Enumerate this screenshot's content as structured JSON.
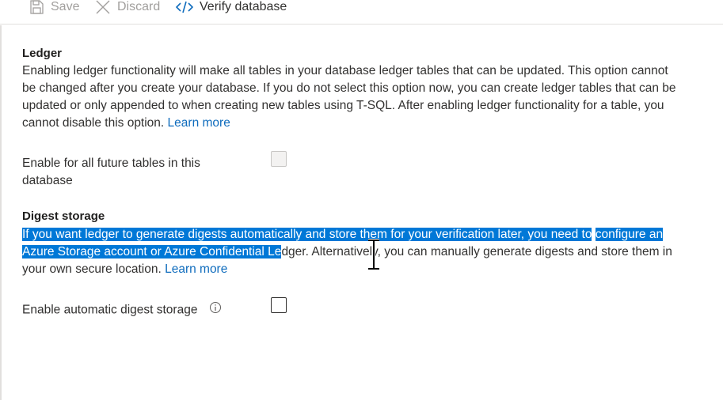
{
  "toolbar": {
    "save_label": "Save",
    "discard_label": "Discard",
    "verify_label": "Verify database"
  },
  "ledger": {
    "title": "Ledger",
    "description": "Enabling ledger functionality will make all tables in your database ledger tables that can be updated. This option cannot be changed after you create your database. If you do not select this option now, you can create ledger tables that can be updated or only appended to when creating new tables using T-SQL. After enabling ledger functionality for a table, you cannot disable this option.",
    "learn_more": "Learn more",
    "enable_label": "Enable for all future tables in this database",
    "enable_checked": false,
    "enable_disabled": true
  },
  "digest": {
    "title": "Digest storage",
    "description_selected_1": "If you want ledger to generate digests automatically and store them for your verification later, you need to",
    "description_selected_2": "configure an Azure Storage account or Azure Confidential Le",
    "description_rest": "dger. Alternatively, you can manually generate digests and store them in your own secure location.",
    "learn_more": "Learn more",
    "enable_label": "Enable automatic digest storage",
    "enable_checked": false
  },
  "icons": {
    "save": "save-icon",
    "discard": "discard-icon",
    "verify": "code-icon",
    "info": "info-icon",
    "cursor": "text-cursor-icon"
  },
  "colors": {
    "link": "#0f6cbd",
    "selection": "#0078d7",
    "disabled_text": "#a19f9d"
  }
}
